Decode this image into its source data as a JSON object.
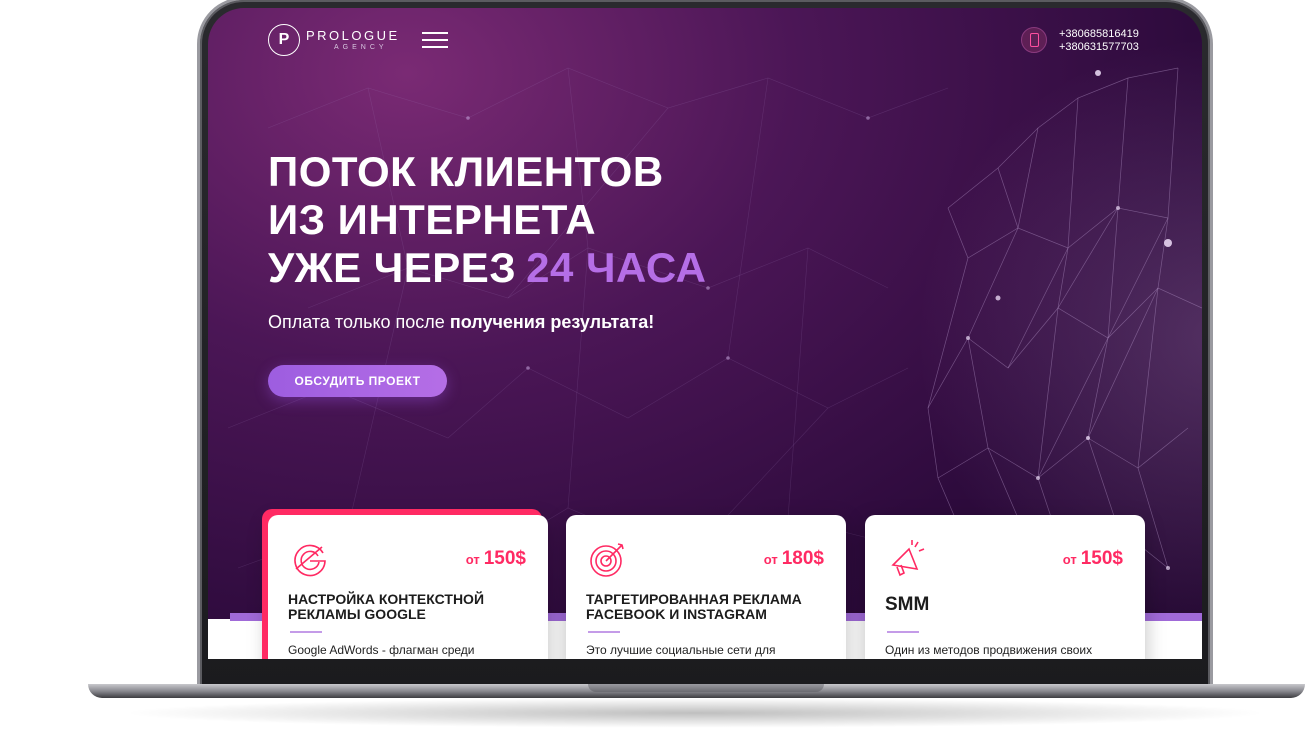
{
  "brand": {
    "name": "PROLOGUE",
    "sub": "AGENCY",
    "mark": "P"
  },
  "header": {
    "phones": [
      "+380685816419",
      "+380631577703"
    ]
  },
  "hero": {
    "line1": "ПОТОК КЛИЕНТОВ",
    "line2": "ИЗ ИНТЕРНЕТА",
    "line3": "УЖЕ ЧЕРЕЗ",
    "accent": "24 ЧАСА",
    "subtitle_regular": "Оплата только после ",
    "subtitle_bold": "получения результата!",
    "cta": "ОБСУДИТЬ ПРОЕКТ"
  },
  "cards": [
    {
      "icon": "google-icon",
      "price_prefix": "от",
      "price": "150$",
      "title": "НАСТРОЙКА КОНТЕКСТНОЙ РЕКЛАМЫ GOOGLE",
      "text": "Google AdWords - флагман среди"
    },
    {
      "icon": "target-icon",
      "price_prefix": "от",
      "price": "180$",
      "title": "ТАРГЕТИРОВАННАЯ РЕКЛАМА FACEBOOK И INSTAGRAM",
      "text": "Это лучшие социальные сети для"
    },
    {
      "icon": "megaphone-icon",
      "price_prefix": "от",
      "price": "150$",
      "title": "SMM",
      "text": "Один из методов продвижения своих"
    }
  ],
  "colors": {
    "accent": "#b56ee6",
    "pink": "#ff2a63",
    "bg": "#2e0b3d"
  }
}
